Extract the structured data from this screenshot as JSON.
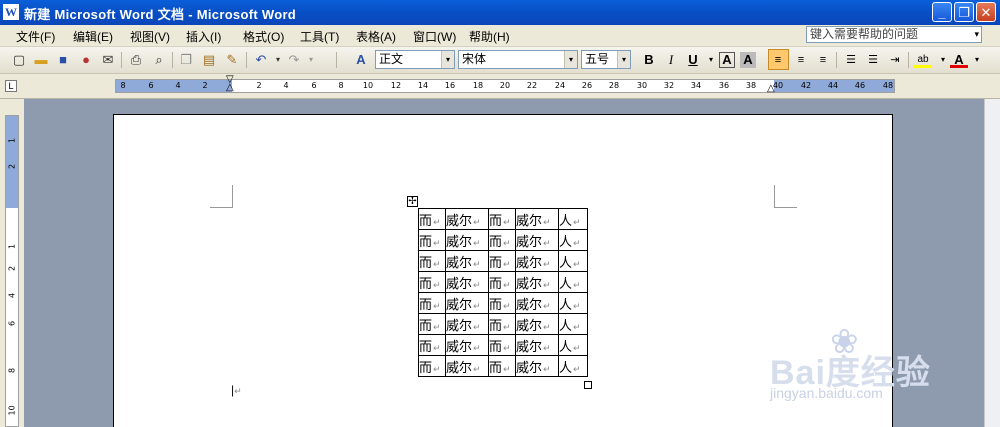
{
  "window": {
    "title": "新建 Microsoft Word 文档 - Microsoft Word",
    "app_icon_glyph": "W",
    "controls": {
      "minimize": "_",
      "maximize": "❐",
      "close": "✕"
    }
  },
  "menubar": {
    "items": [
      "文件(F)",
      "编辑(E)",
      "视图(V)",
      "插入(I)",
      "格式(O)",
      "工具(T)",
      "表格(A)",
      "窗口(W)",
      "帮助(H)"
    ],
    "help_placeholder": "键入需要帮助的问题",
    "help_dropdown": "▾"
  },
  "toolbar": {
    "style_value": "正文",
    "style_icon_glyph": "A",
    "font_value": "宋体",
    "size_value": "五号",
    "bold": "B",
    "italic": "I",
    "underline": "U",
    "char_border": "A",
    "char_shading": "A",
    "font_color": "A",
    "combo_arrow": "▾"
  },
  "ruler": {
    "corner_glyph": "L",
    "h_ticks": [
      "8",
      "6",
      "4",
      "2",
      "2",
      "4",
      "6",
      "8",
      "10",
      "12",
      "14",
      "16",
      "18",
      "20",
      "22",
      "24",
      "26",
      "28",
      "30",
      "32",
      "34",
      "36",
      "38",
      "40",
      "42",
      "44",
      "46",
      "48"
    ],
    "v_ticks": [
      "1",
      "2",
      "1",
      "2",
      "4",
      "6",
      "8",
      "10"
    ]
  },
  "table": {
    "rows": [
      [
        "而",
        "威尔",
        "而",
        "威尔",
        "人"
      ],
      [
        "而",
        "威尔",
        "而",
        "威尔",
        "人"
      ],
      [
        "而",
        "威尔",
        "而",
        "威尔",
        "人"
      ],
      [
        "而",
        "威尔",
        "而",
        "威尔",
        "人"
      ],
      [
        "而",
        "威尔",
        "而",
        "威尔",
        "人"
      ],
      [
        "而",
        "威尔",
        "而",
        "威尔",
        "人"
      ],
      [
        "而",
        "威尔",
        "而",
        "威尔",
        "人"
      ],
      [
        "而",
        "威尔",
        "而",
        "威尔",
        "人"
      ]
    ],
    "cell_mark": "↵",
    "move_handle_glyph": "✢"
  },
  "document": {
    "paragraph_mark": "↵"
  },
  "watermark": {
    "brand": "Bai度经验",
    "paw": "❀",
    "url": "jingyan.baidu.com"
  }
}
